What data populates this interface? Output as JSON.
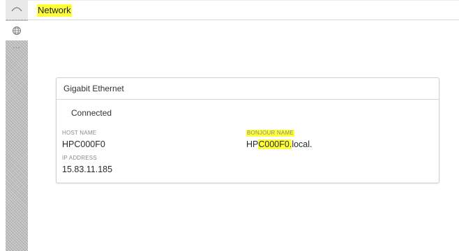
{
  "header": {
    "title": "Network"
  },
  "sidebar": {
    "more_label": "..."
  },
  "card": {
    "title": "Gigabit Ethernet",
    "status": "Connected",
    "host_name": {
      "label": "HOST NAME",
      "value": "HPC000F0"
    },
    "ip_address": {
      "label": "IP ADDRESS",
      "value": "15.83.11.185"
    },
    "bonjour_name": {
      "label": "BONJOUR NAME",
      "value_prefix": "HP",
      "value_highlight": "C000F0.",
      "value_suffix": "local."
    }
  },
  "colors": {
    "highlight": "#ffff3a",
    "rail": "#bdbdbd",
    "border": "#cfcfcf"
  },
  "icons": [
    "arc-icon",
    "globe-icon",
    "more-icon"
  ]
}
